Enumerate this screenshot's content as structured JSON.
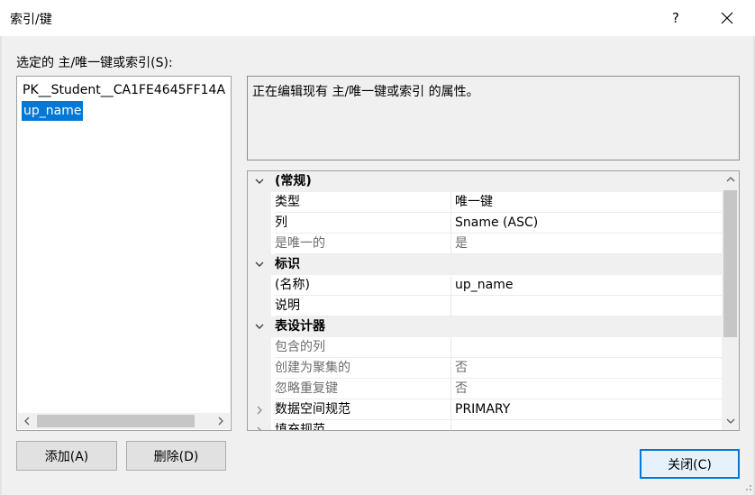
{
  "window": {
    "title": "索引/键",
    "help_label": "?"
  },
  "list": {
    "label": "选定的 主/唯一键或索引(S):",
    "items": [
      {
        "label": "PK__Student__CA1FE4645FF14A",
        "selected": false
      },
      {
        "label": "up_name",
        "selected": true
      }
    ]
  },
  "description": "正在编辑现有 主/唯一键或索引 的属性。",
  "properties": {
    "categories": [
      {
        "name": "(常规)",
        "expanded": true,
        "rows": [
          {
            "name": "类型",
            "value": "唯一键",
            "disabled": false
          },
          {
            "name": "列",
            "value": "Sname (ASC)",
            "disabled": false
          },
          {
            "name": "是唯一的",
            "value": "是",
            "disabled": true
          }
        ]
      },
      {
        "name": "标识",
        "expanded": true,
        "rows": [
          {
            "name": "(名称)",
            "value": "up_name",
            "disabled": false
          },
          {
            "name": "说明",
            "value": "",
            "disabled": false
          }
        ]
      },
      {
        "name": "表设计器",
        "expanded": true,
        "rows": [
          {
            "name": "包含的列",
            "value": "",
            "disabled": true
          },
          {
            "name": "创建为聚集的",
            "value": "否",
            "disabled": true
          },
          {
            "name": "忽略重复键",
            "value": "否",
            "disabled": true
          },
          {
            "name": "数据空间规范",
            "value": "PRIMARY",
            "disabled": false,
            "expandable": true
          },
          {
            "name": "填充规范",
            "value": "",
            "disabled": false,
            "expandable": true
          }
        ]
      }
    ]
  },
  "buttons": {
    "add": "添加(A)",
    "delete": "删除(D)",
    "close": "关闭(C)"
  },
  "icons": {
    "close": "close-icon",
    "expanded": "chevron-down-icon",
    "collapsed": "chevron-right-icon",
    "scroll_up": "scroll-up-arrow-icon",
    "scroll_down": "scroll-down-arrow-icon",
    "scroll_left": "scroll-left-arrow-icon",
    "scroll_right": "scroll-right-arrow-icon"
  },
  "colors": {
    "selection": "#0078d7",
    "dialog_bg": "#f0f0f0",
    "default_button_border": "#0078d7"
  }
}
